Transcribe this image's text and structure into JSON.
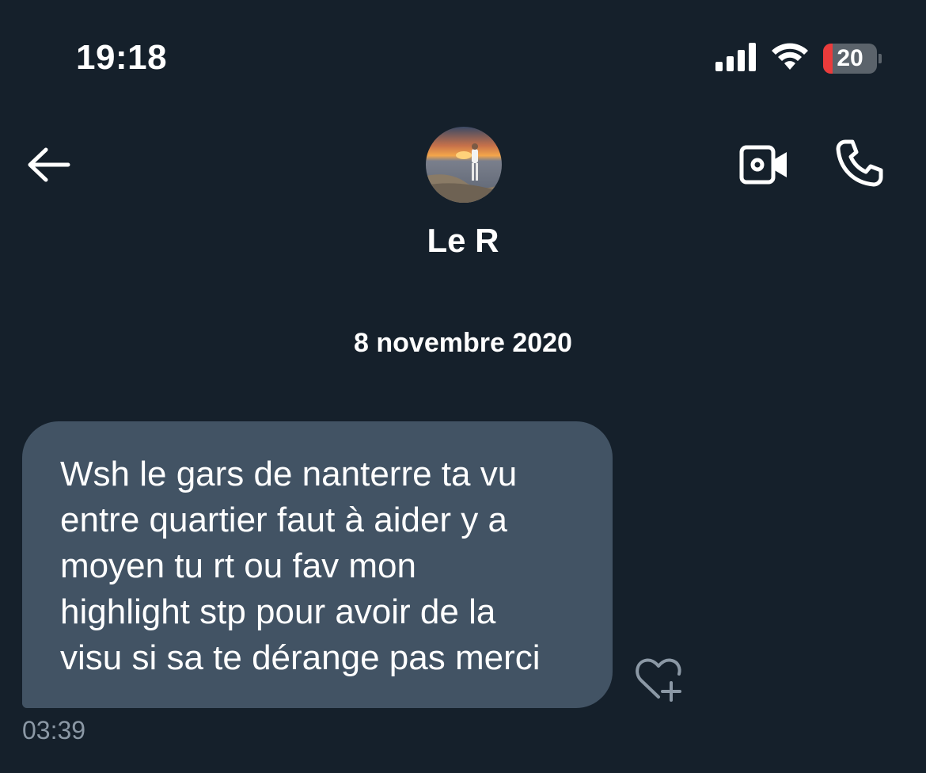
{
  "status_bar": {
    "time": "19:18",
    "battery_level": "20",
    "icons": [
      "cellular-signal-icon",
      "wifi-icon",
      "battery-icon"
    ]
  },
  "header": {
    "back_icon": "arrow-left-icon",
    "contact_name": "Le R",
    "avatar": "contact-avatar-photo",
    "video_icon": "video-camera-icon",
    "call_icon": "phone-icon"
  },
  "conversation": {
    "date_separator": "8 novembre 2020",
    "messages": [
      {
        "text": "Wsh le gars de nanterre ta vu\nentre quartier faut à aider y a\nmoyen tu rt ou fav mon\nhighlight stp pour avoir de la\nvisu si sa te dérange pas merci",
        "time": "03:39",
        "reaction_icon": "heart-plus-icon"
      }
    ]
  },
  "colors": {
    "background": "#15202b",
    "bubble": "#425364",
    "secondary_text": "#8b98a5",
    "battery_low": "#eb3b3b"
  }
}
